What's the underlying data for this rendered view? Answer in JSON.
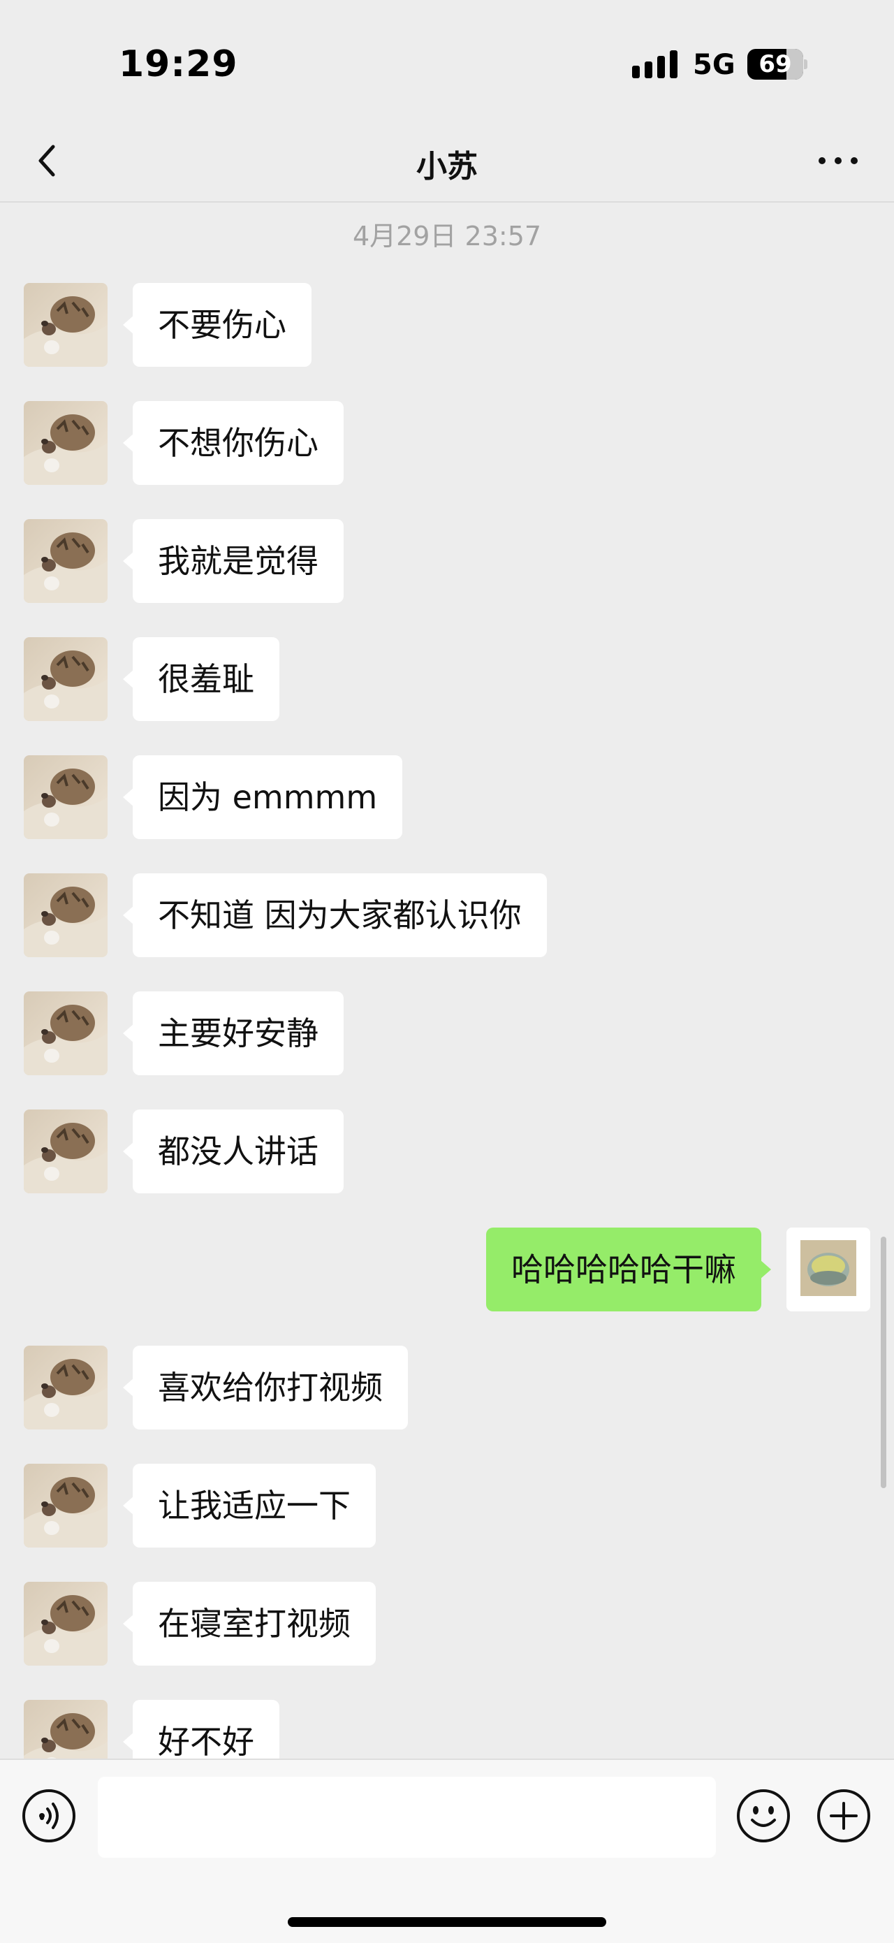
{
  "status_bar": {
    "time": "19:29",
    "network": "5G",
    "battery": "69",
    "battery_level": 0.69
  },
  "nav": {
    "title": "小苏"
  },
  "chat": {
    "timestamp": "4月29日 23:57",
    "messages": [
      {
        "sender": "other",
        "text": "不要伤心"
      },
      {
        "sender": "other",
        "text": "不想你伤心"
      },
      {
        "sender": "other",
        "text": "我就是觉得"
      },
      {
        "sender": "other",
        "text": "很羞耻"
      },
      {
        "sender": "other",
        "text": "因为 emmmm"
      },
      {
        "sender": "other",
        "text": "不知道 因为大家都认识你"
      },
      {
        "sender": "other",
        "text": "主要好安静"
      },
      {
        "sender": "other",
        "text": "都没人讲话"
      },
      {
        "sender": "me",
        "text": "哈哈哈哈哈干嘛"
      },
      {
        "sender": "other",
        "text": "喜欢给你打视频"
      },
      {
        "sender": "other",
        "text": "让我适应一下"
      },
      {
        "sender": "other",
        "text": "在寝室打视频"
      },
      {
        "sender": "other",
        "text": "好不好"
      }
    ]
  },
  "input_bar": {
    "text_value": "",
    "icons": [
      "voice-icon",
      "emoji-icon",
      "plus-icon"
    ]
  },
  "colors": {
    "background": "#ededed",
    "my_bubble": "#95ec69",
    "other_bubble": "#ffffff"
  }
}
